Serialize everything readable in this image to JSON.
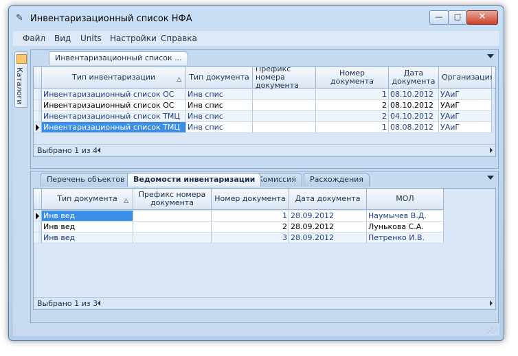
{
  "window": {
    "title": "Инвентаризационный список НФА",
    "min_glyph": "—",
    "max_glyph": "□",
    "close_glyph": "✕"
  },
  "menu": [
    "Файл",
    "Вид",
    "Units",
    "Настройки",
    "Справка"
  ],
  "side_tab": {
    "label": "Каталоги"
  },
  "top_panel": {
    "tab_label": "Инвентаризационный список ...",
    "columns": [
      "Тип инвентаризации",
      "Тип документа",
      "Префикс номера документа",
      "Номер документа",
      "Дата документа",
      "Организация"
    ],
    "sorted_column": "Тип инвентаризации",
    "rows": [
      {
        "type": "Инвентаризационный список ОС",
        "doc_type": "Инв спис",
        "prefix": "",
        "number": "1",
        "date": "08.10.2012",
        "org": "УАиГ"
      },
      {
        "type": "Инвентаризационный список ОС",
        "doc_type": "Инв спис",
        "prefix": "",
        "number": "2",
        "date": "08.10.2012",
        "org": "УАиГ"
      },
      {
        "type": "Инвентаризационный список ТМЦ",
        "doc_type": "Инв спис",
        "prefix": "",
        "number": "2",
        "date": "04.10.2012",
        "org": "УАиГ"
      },
      {
        "type": "Инвентаризационный список ТМЦ",
        "doc_type": "Инв спис",
        "prefix": "",
        "number": "1",
        "date": "08.08.2012",
        "org": "УАиГ"
      }
    ],
    "status": "Выбрано 1 из 4"
  },
  "bottom_panel": {
    "tabs": [
      "Перечень объектов",
      "Ведомости инвентаризации",
      "Комиссия",
      "Расхождения"
    ],
    "active_tab": "Ведомости инвентаризации",
    "columns": [
      "Тип документа",
      "Префикс номера документа",
      "Номер документа",
      "Дата документа",
      "МОЛ"
    ],
    "rows": [
      {
        "doc_type": "Инв вед",
        "prefix": "",
        "number": "1",
        "date": "28.09.2012",
        "mol": "Наумычев В.Д."
      },
      {
        "doc_type": "Инв вед",
        "prefix": "",
        "number": "2",
        "date": "28.09.2012",
        "mol": "Лунькова С.А."
      },
      {
        "doc_type": "Инв вед",
        "prefix": "",
        "number": "3",
        "date": "28.09.2012",
        "mol": "Петренко И.В."
      }
    ],
    "status": "Выбрано 1 из 3"
  },
  "icons": [
    "app-icon",
    "catalog-icon",
    "sort-triangle-icon",
    "dropdown-arrow-icon",
    "row-marker-icon",
    "scroll-left-icon",
    "scroll-right-icon",
    "resize-grip-icon"
  ],
  "colors": {
    "selection": "#3a8ee6",
    "panel": "#c5d9f1",
    "link_text": "#1c3d86"
  }
}
